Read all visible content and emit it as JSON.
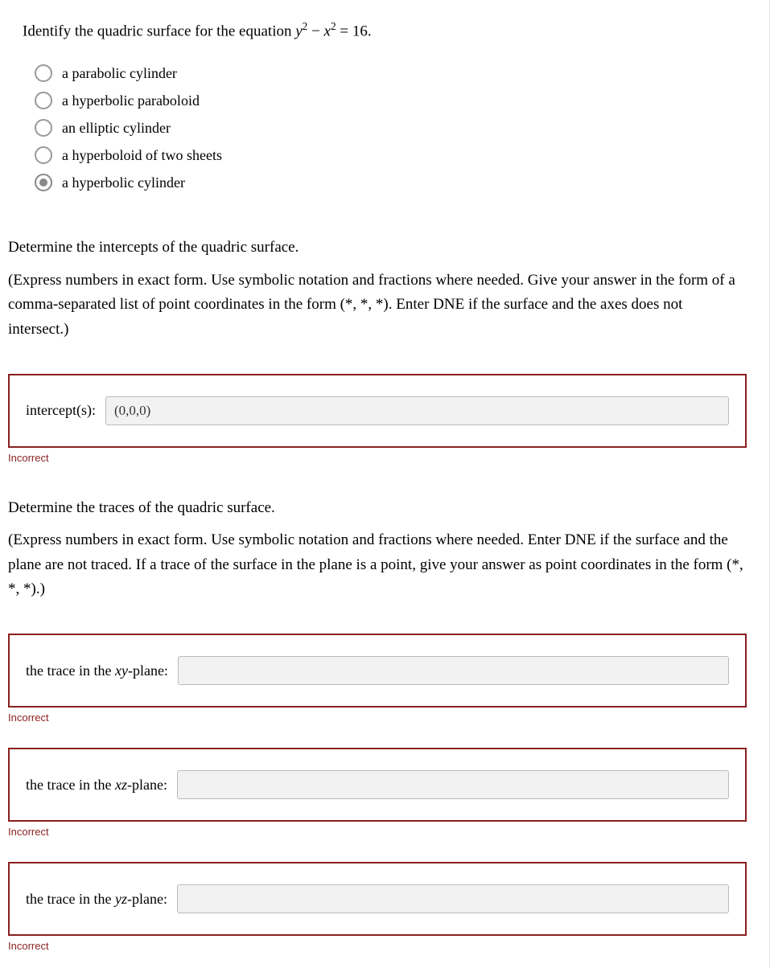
{
  "question": {
    "prefix": "Identify the quadric surface for the equation ",
    "eq_lhs_y": "y",
    "eq_exp1": "2",
    "eq_minus": " − ",
    "eq_lhs_x": "x",
    "eq_exp2": "2",
    "eq_rhs": " = 16."
  },
  "options": [
    {
      "label": "a parabolic cylinder",
      "selected": false
    },
    {
      "label": "a hyperbolic paraboloid",
      "selected": false
    },
    {
      "label": "an elliptic cylinder",
      "selected": false
    },
    {
      "label": "a hyperboloid of two sheets",
      "selected": false
    },
    {
      "label": "a hyperbolic cylinder",
      "selected": true
    }
  ],
  "intercepts_section": {
    "line1": "Determine the intercepts of the quadric surface.",
    "line2": "(Express numbers in exact form. Use symbolic notation and fractions where needed. Give your answer in the form of a comma-separated list of point coordinates in the form (*, *, *). Enter DNE if the surface and the axes does not intersect.)"
  },
  "intercepts_box": {
    "label": "intercept(s):",
    "value": "(0,0,0)",
    "feedback": "Incorrect"
  },
  "traces_section": {
    "line1": "Determine the traces of the quadric surface.",
    "line2": "(Express numbers in exact form. Use symbolic notation and fractions where needed. Enter DNE if the surface and the plane are not traced. If a trace of the surface in the plane is a point, give your answer as point coordinates in the form (*, *, *).)"
  },
  "trace_xy": {
    "label_prefix": "the trace in the ",
    "plane_a": "x",
    "plane_b": "y",
    "label_suffix": "-plane:",
    "value": "",
    "feedback": "Incorrect"
  },
  "trace_xz": {
    "label_prefix": "the trace in the ",
    "plane_a": "x",
    "plane_b": "z",
    "label_suffix": "-plane:",
    "value": "",
    "feedback": "Incorrect"
  },
  "trace_yz": {
    "label_prefix": "the trace in the ",
    "plane_a": "y",
    "plane_b": "z",
    "label_suffix": "-plane:",
    "value": "",
    "feedback": "Incorrect"
  }
}
